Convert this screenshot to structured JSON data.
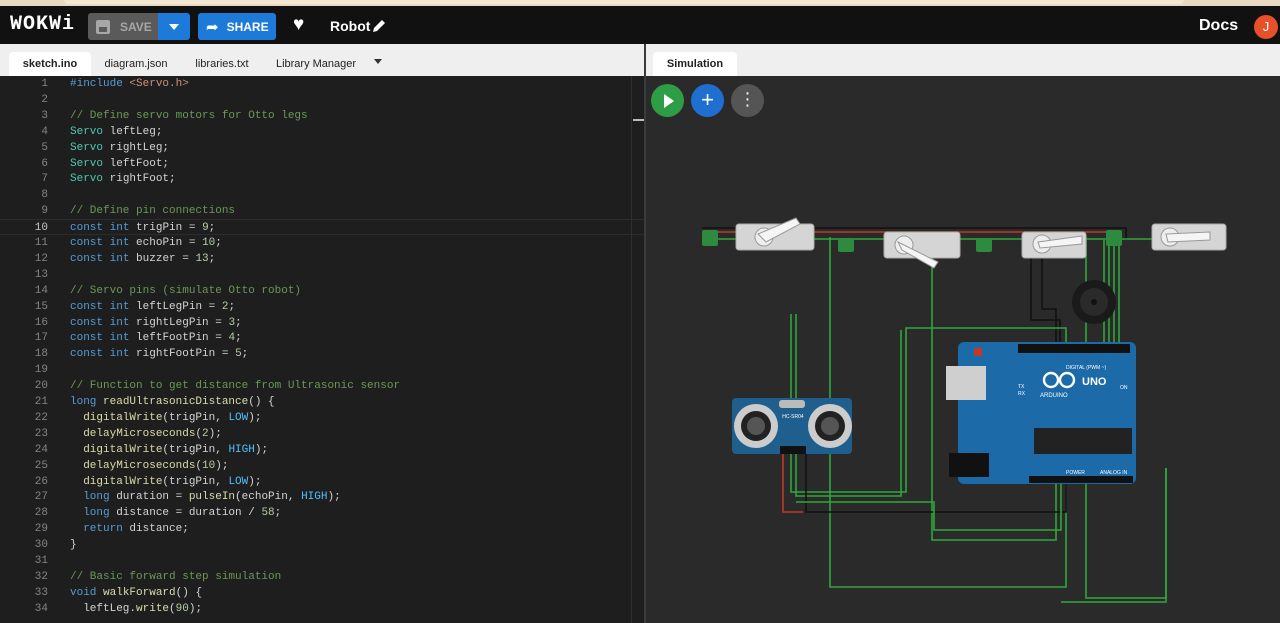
{
  "app": {
    "logo": "WOKWi",
    "project_title": "Robot",
    "docs_label": "Docs",
    "user_initial": "J"
  },
  "toolbar": {
    "save_label": "SAVE",
    "share_label": "SHARE"
  },
  "editor": {
    "tabs": [
      {
        "label": "sketch.ino",
        "active": true
      },
      {
        "label": "diagram.json",
        "active": false
      },
      {
        "label": "libraries.txt",
        "active": false
      },
      {
        "label": "Library Manager",
        "active": false
      }
    ],
    "current_line": 10,
    "lines": [
      "#include <Servo.h>",
      "",
      "// Define servo motors for Otto legs",
      "Servo leftLeg;",
      "Servo rightLeg;",
      "Servo leftFoot;",
      "Servo rightFoot;",
      "",
      "// Define pin connections",
      "const int trigPin = 9;",
      "const int echoPin = 10;",
      "const int buzzer = 13;",
      "",
      "// Servo pins (simulate Otto robot)",
      "const int leftLegPin = 2;",
      "const int rightLegPin = 3;",
      "const int leftFootPin = 4;",
      "const int rightFootPin = 5;",
      "",
      "// Function to get distance from Ultrasonic sensor",
      "long readUltrasonicDistance() {",
      "  digitalWrite(trigPin, LOW);",
      "  delayMicroseconds(2);",
      "  digitalWrite(trigPin, HIGH);",
      "  delayMicroseconds(10);",
      "  digitalWrite(trigPin, LOW);",
      "  long duration = pulseIn(echoPin, HIGH);",
      "  long distance = duration / 58;",
      "  return distance;",
      "}",
      "",
      "// Basic forward step simulation",
      "void walkForward() {",
      "  leftLeg.write(90);"
    ]
  },
  "simulation": {
    "tab_label": "Simulation",
    "buttons": [
      "play-icon",
      "plus-icon",
      "more-vertical-icon"
    ],
    "parts": {
      "sensor_label": "HC-SR04",
      "board_label": "UNO",
      "board_brand": "ARDUINO",
      "digital_label": "DIGITAL (PWM ~)",
      "analog_label": "ANALOG IN",
      "power_label": "POWER",
      "on_label": "ON",
      "tx_label": "TX",
      "rx_label": "RX"
    }
  },
  "colors": {
    "accent_blue": "#1e7ad8",
    "play_green": "#2e9e46",
    "board_blue": "#1c6aa8",
    "wire_green": "#2fa83b"
  }
}
